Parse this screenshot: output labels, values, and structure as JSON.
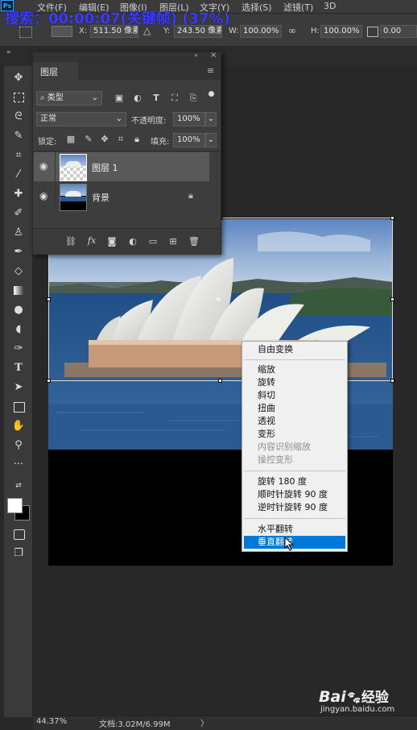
{
  "overlay_title": "搜索：00:00:07(关键帧) (37%)",
  "menubar": {
    "logo": "Ps",
    "items": [
      "文件(F)",
      "编辑(E)",
      "图像(I)",
      "图层(L)",
      "文字(Y)",
      "选择(S)",
      "滤镜(T)",
      "3D"
    ]
  },
  "options": {
    "x_label": "X:",
    "x_value": "511.50 像素",
    "y_label": "Y:",
    "y_value": "243.50 像素",
    "w_label": "W:",
    "w_value": "100.00%",
    "h_label": "H:",
    "h_value": "100.00%",
    "angle_value": "0.00"
  },
  "layers_panel": {
    "title": "图层",
    "filter_label": "类型",
    "blend_mode": "正常",
    "opacity_label": "不透明度:",
    "opacity_value": "100%",
    "lock_label": "锁定:",
    "fill_label": "填充:",
    "fill_value": "100%",
    "layers": [
      {
        "name": "图层 1",
        "selected": true,
        "visible": true
      },
      {
        "name": "背景",
        "selected": false,
        "visible": true,
        "locked": true
      }
    ]
  },
  "context_menu": {
    "items": [
      {
        "label": "自由变换",
        "disabled": false
      },
      {
        "label": "缩放",
        "disabled": false
      },
      {
        "label": "旋转",
        "disabled": false
      },
      {
        "label": "斜切",
        "disabled": false
      },
      {
        "label": "扭曲",
        "disabled": false
      },
      {
        "label": "透视",
        "disabled": false
      },
      {
        "label": "变形",
        "disabled": false
      },
      {
        "label": "内容识别缩放",
        "disabled": true
      },
      {
        "label": "操控变形",
        "disabled": true
      },
      {
        "label": "旋转 180 度",
        "disabled": false
      },
      {
        "label": "顺时针旋转 90 度",
        "disabled": false
      },
      {
        "label": "逆时针旋转 90 度",
        "disabled": false
      },
      {
        "label": "水平翻转",
        "disabled": false
      },
      {
        "label": "垂直翻转",
        "disabled": false,
        "selected": true
      }
    ]
  },
  "status": {
    "zoom": "44.37%",
    "doc_info": "文档:3.02M/6.99M",
    "arrow": "〉"
  },
  "watermark": {
    "brand_a": "Bai",
    "brand_b": "经验",
    "url": "jingyan.baidu.com"
  },
  "colors": {
    "selection_highlight": "#0078d7",
    "overlay_title": "#3b3bff"
  }
}
